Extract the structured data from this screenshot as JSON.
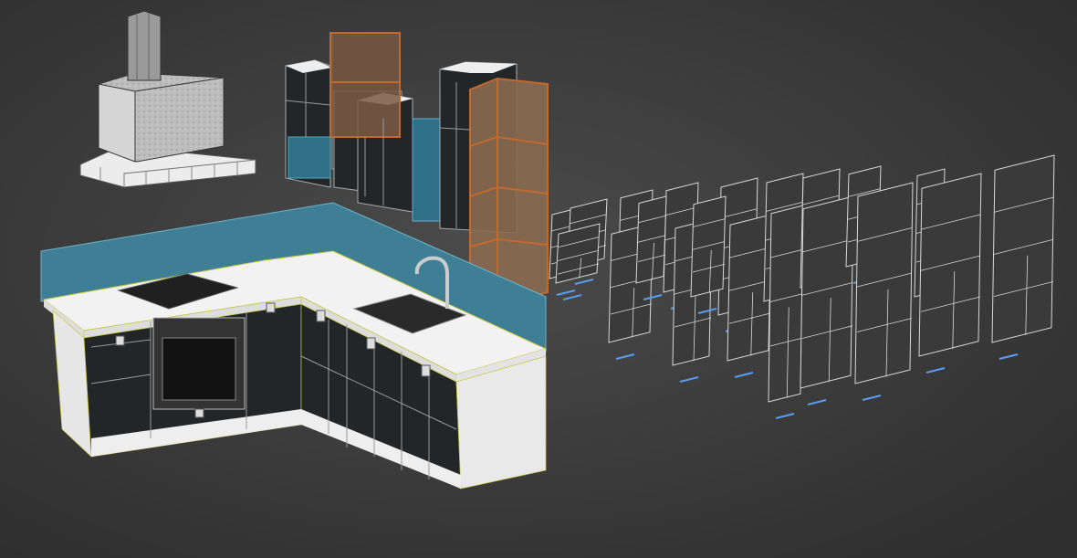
{
  "viewport": {
    "background_center": "#4b4b4b",
    "background_edge": "#2f2f2f",
    "cabinet_front": "#232629",
    "cabinet_white": "#e6e6e6",
    "countertop": "#f2f2f2",
    "backsplash": "#3f7f96",
    "selected_frame": "#b8622a",
    "selected_wall": "#8a6a4f",
    "wire": "#d8d8d8",
    "label_color": "#5a9cf0"
  }
}
